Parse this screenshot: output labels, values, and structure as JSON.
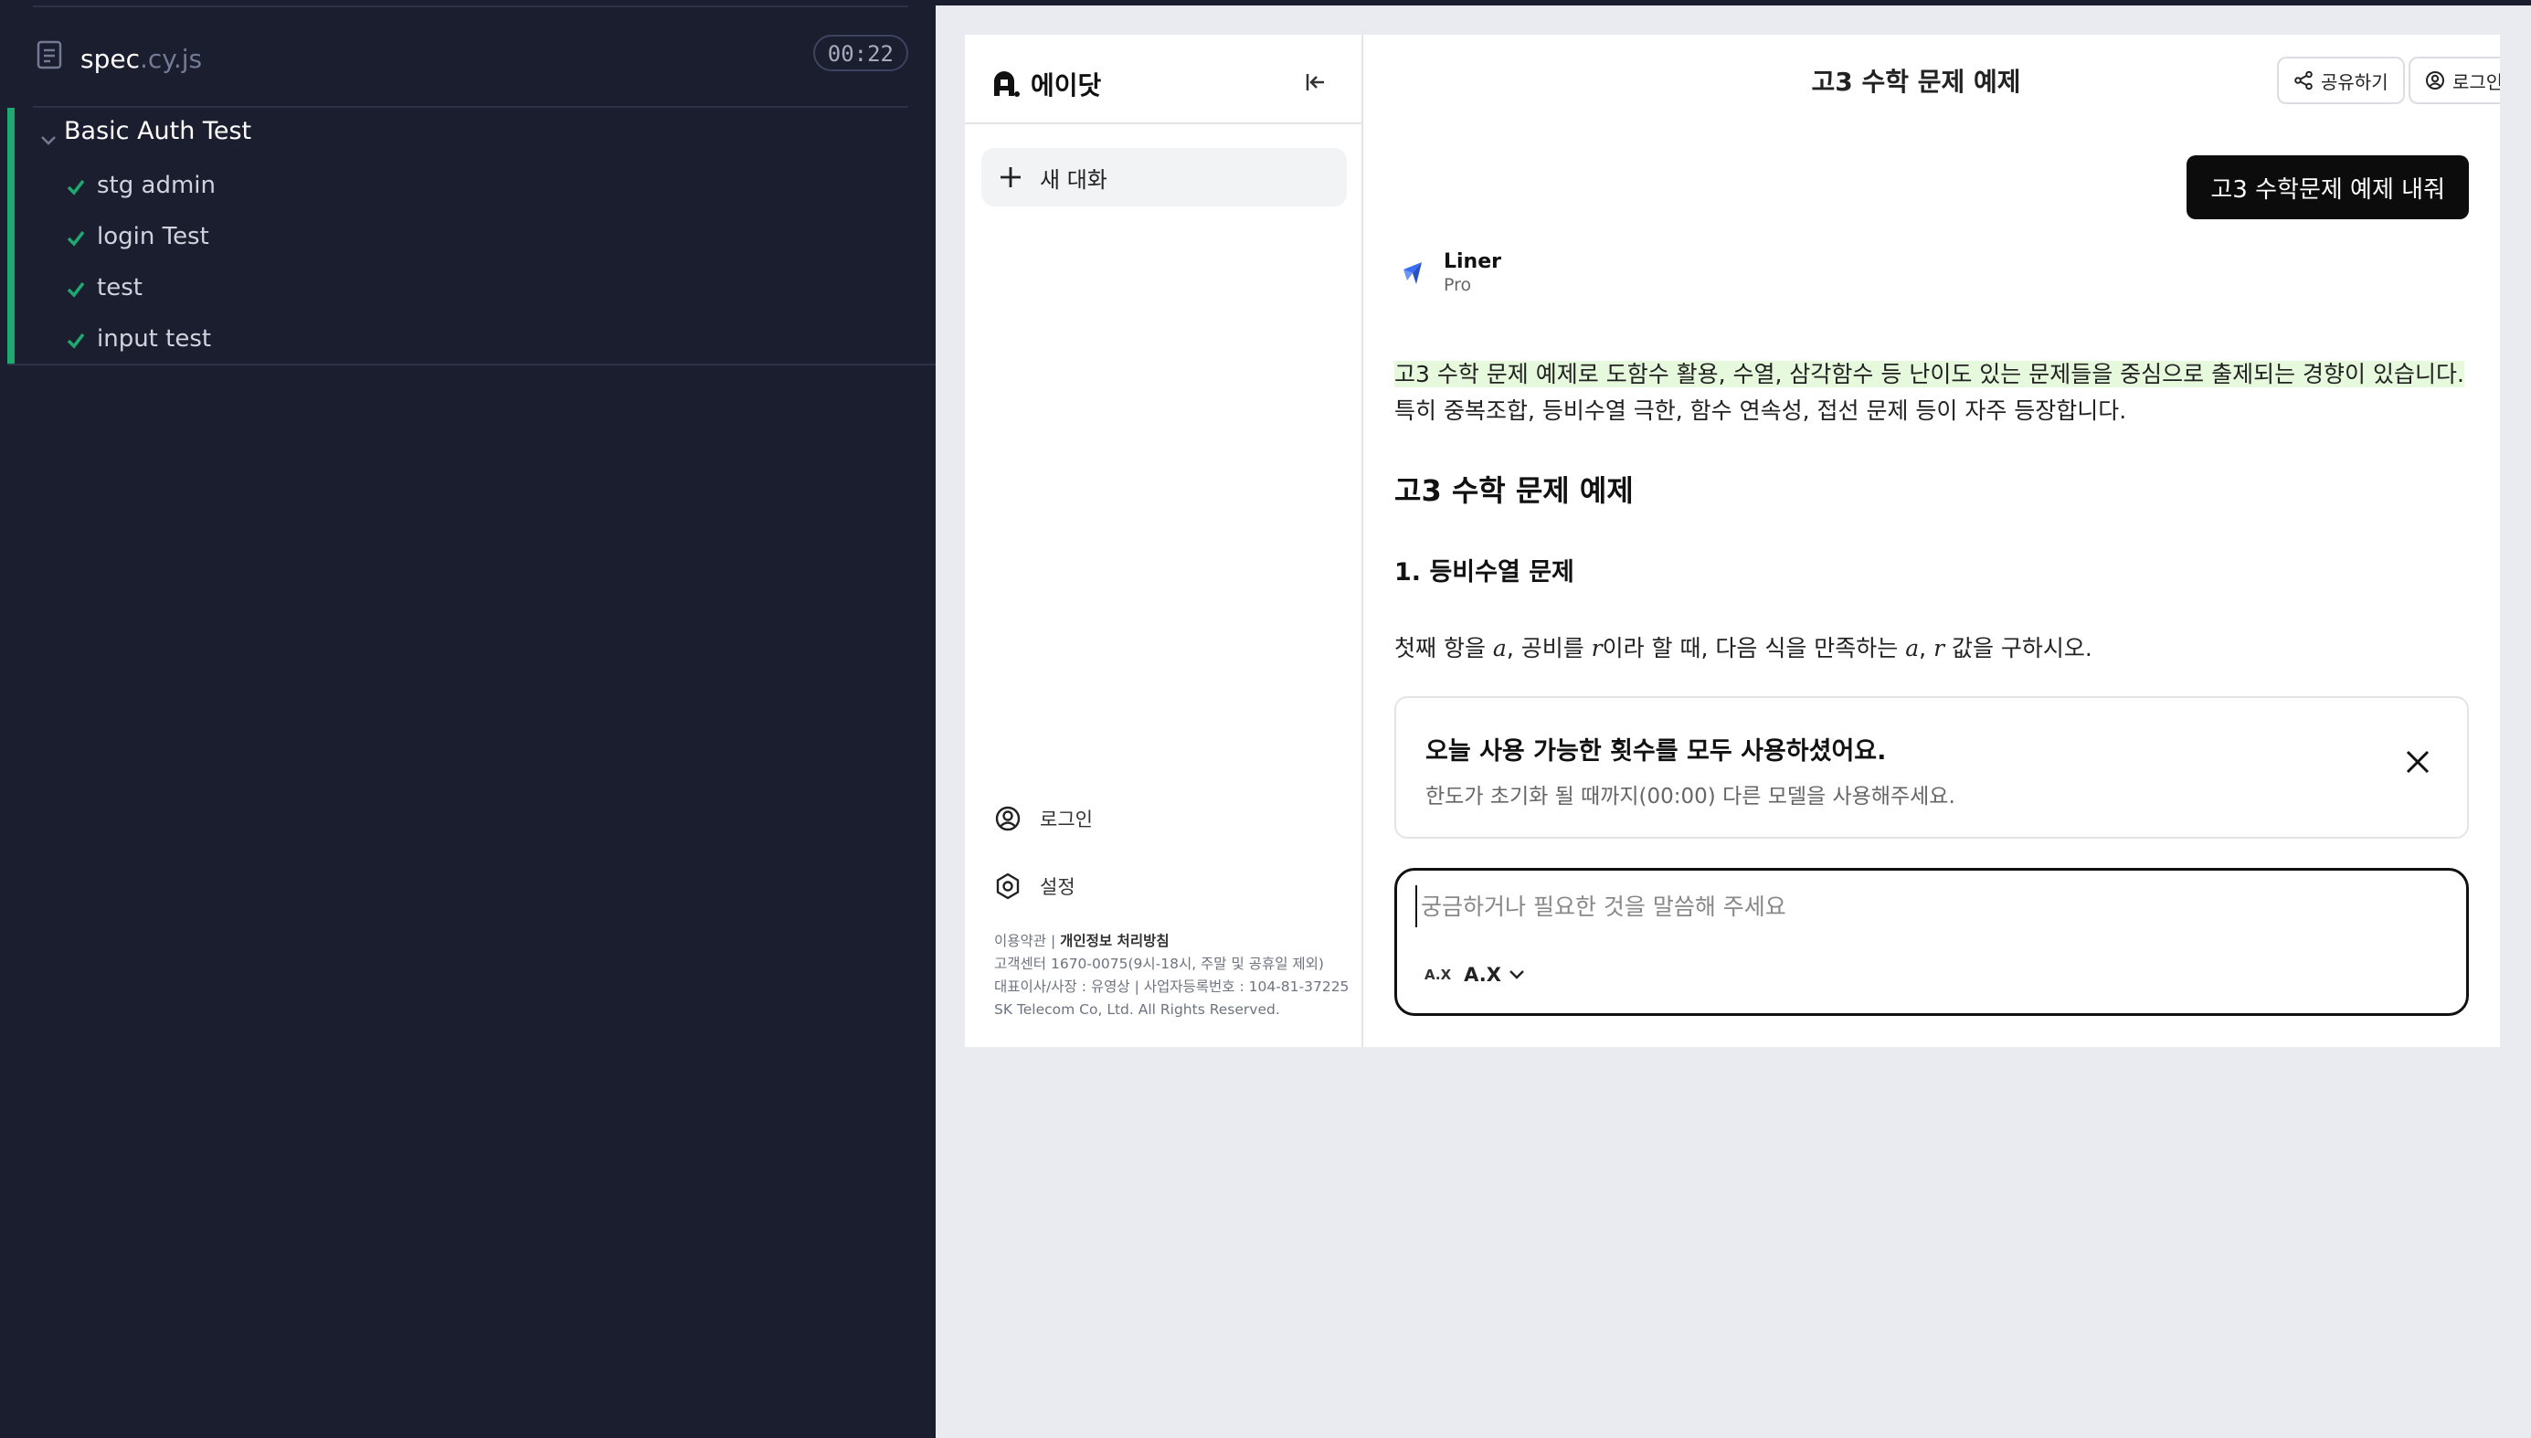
{
  "runner": {
    "spec_name": "spec",
    "spec_ext": ".cy.js",
    "timer": "00:22",
    "suite_title": "Basic Auth Test",
    "tests": [
      {
        "label": "stg admin"
      },
      {
        "label": "login Test"
      },
      {
        "label": "test"
      },
      {
        "label": "input test"
      }
    ],
    "colors": {
      "pass": "#1fa971",
      "bg": "#1b1e2e"
    }
  },
  "app": {
    "brand": "에이닷",
    "sidebar": {
      "new_chat": "새 대화",
      "login": "로그인",
      "settings": "설정",
      "footer": {
        "terms": "이용약관",
        "separator": " | ",
        "privacy": "개인정보 처리방침",
        "customer_center": "고객센터 1670-0075(9시-18시, 주말 및 공휴일 제외)",
        "ceo_line": "대표이사/사장 : 유영상 | 사업자등록번호 : 104-81-37225",
        "copyright": "SK Telecom Co, Ltd. All Rights Reserved."
      }
    },
    "header": {
      "title": "고3 수학 문제 예제",
      "share": "공유하기",
      "login": "로그인"
    },
    "user_message": "고3 수학문제 예제 내줘",
    "model": {
      "name": "Liner",
      "tier": "Pro"
    },
    "answer": {
      "intro_highlight": "고3 수학 문제 예제로 도함수 활용, 수열, 삼각함수 등 난이도 있는 문제들을 중심으로 출제되는 경향이 있습니다.",
      "intro_rest": "특히 중복조합, 등비수열 극한, 함수 연속성, 접선 문제 등이 자주 등장합니다.",
      "heading": "고3 수학 문제 예제",
      "subheading": "1. 등비수열 문제",
      "p_part1": "첫째 항을 ",
      "var_a": "a",
      "p_part2": ", 공비를 ",
      "var_r": "r",
      "p_part3": "이라 할 때, 다음 식을 만족하는 ",
      "p_part4": ", ",
      "p_part5": " 값을 구하시오."
    },
    "limit_notice": {
      "title": "오늘 사용 가능한 횟수를 모두 사용하셨어요.",
      "description": "한도가 초기화 될 때까지(00:00) 다른 모델을 사용해주세요."
    },
    "composer": {
      "placeholder": "궁금하거나 필요한 것을 말씀해 주세요",
      "model_logo": "A.X",
      "model_label": "A.X"
    },
    "colors": {
      "highlight": "#e6f9dc",
      "bubble": "#0c0c0c"
    }
  }
}
